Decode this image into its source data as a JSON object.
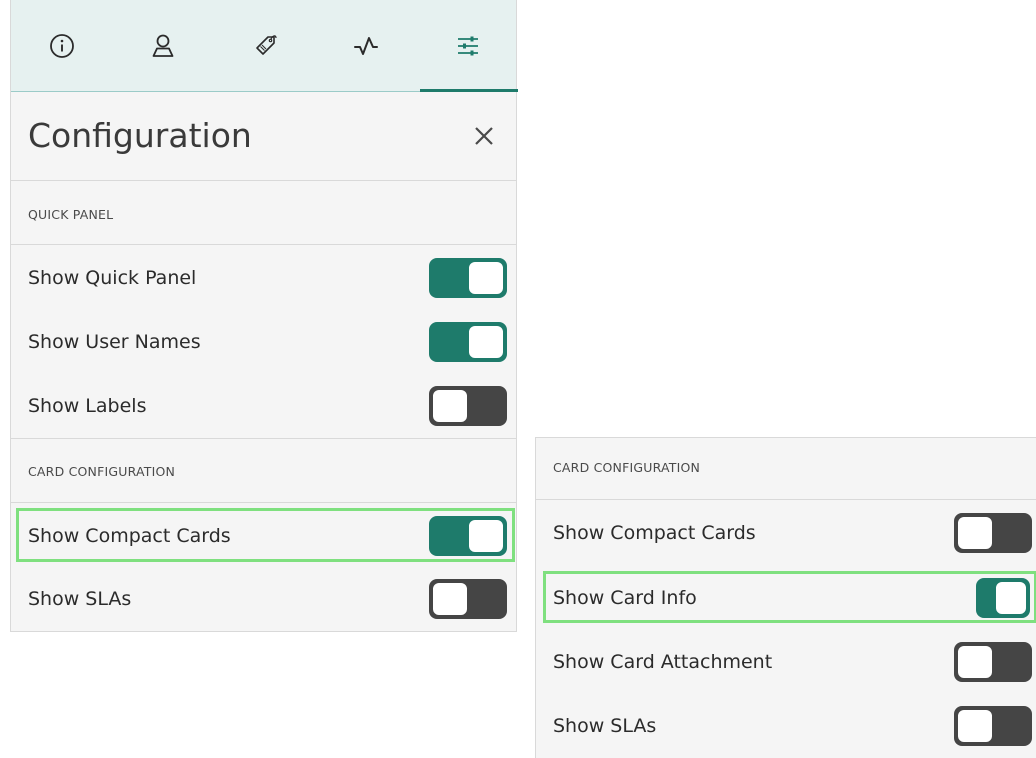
{
  "tabs": [
    {
      "icon": "info-icon"
    },
    {
      "icon": "user-icon"
    },
    {
      "icon": "tag-icon"
    },
    {
      "icon": "activity-icon"
    },
    {
      "icon": "sliders-icon",
      "active": true
    }
  ],
  "config": {
    "title": "Configuration"
  },
  "quick_panel": {
    "header": "QUICK PANEL",
    "rows": [
      {
        "label": "Show Quick Panel",
        "on": true
      },
      {
        "label": "Show User Names",
        "on": true
      },
      {
        "label": "Show Labels",
        "on": false
      }
    ]
  },
  "card_config_left": {
    "header": "CARD CONFIGURATION",
    "rows": [
      {
        "label": "Show Compact Cards",
        "on": true,
        "highlighted": true
      },
      {
        "label": "Show SLAs",
        "on": false
      }
    ]
  },
  "card_config_right": {
    "header": "CARD CONFIGURATION",
    "rows": [
      {
        "label": "Show Compact Cards",
        "on": false
      },
      {
        "label": "Show Card Info",
        "on": true,
        "highlighted": true
      },
      {
        "label": "Show Card Attachment",
        "on": false
      },
      {
        "label": "Show SLAs",
        "on": false
      }
    ]
  },
  "colors": {
    "accent": "#1e7b6b",
    "toggle_off": "#454545",
    "highlight": "#7fe07f",
    "tabbar_bg": "#e6f1f0"
  }
}
